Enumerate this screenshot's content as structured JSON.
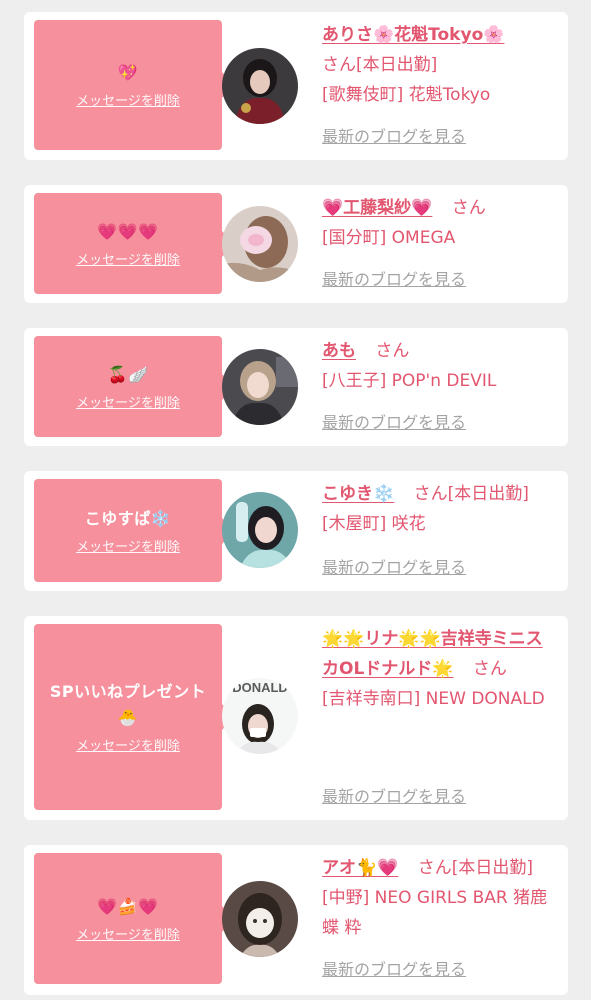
{
  "delete_label": "メッセージを削除",
  "blog_label": "最新のブログを見る",
  "cards": [
    {
      "message": "💖",
      "name": "ありさ🌸花魁Tokyo🌸",
      "suffix": "さん[本日出勤]",
      "shop": "[歌舞伎町] 花魁Tokyo"
    },
    {
      "message": "💗💗💗",
      "name": "💗工藤梨紗💗",
      "suffix": "さん",
      "shop": "[国分町] OMEGA"
    },
    {
      "message": "🍒🪽",
      "name": "あも",
      "suffix": "さん",
      "shop": "[八王子] POP'n DEVIL"
    },
    {
      "message": "こゆすぱ❄️",
      "name": "こゆき❄️",
      "suffix": "さん[本日出勤]",
      "shop": "[木屋町] 咲花"
    },
    {
      "message": "SPいいねプレゼント🐣",
      "name": "🌟🌟リナ🌟🌟吉祥寺ミニスカOLドナルド🌟",
      "suffix": "さん",
      "shop": "[吉祥寺南口] NEW DONALD",
      "avatar_text": "DONALD"
    },
    {
      "message": "💗🍰💗",
      "name": "アオ🐈💗",
      "suffix": "さん[本日出勤]",
      "shop": "[中野] NEO GIRLS BAR 猪鹿蝶 粋"
    }
  ]
}
